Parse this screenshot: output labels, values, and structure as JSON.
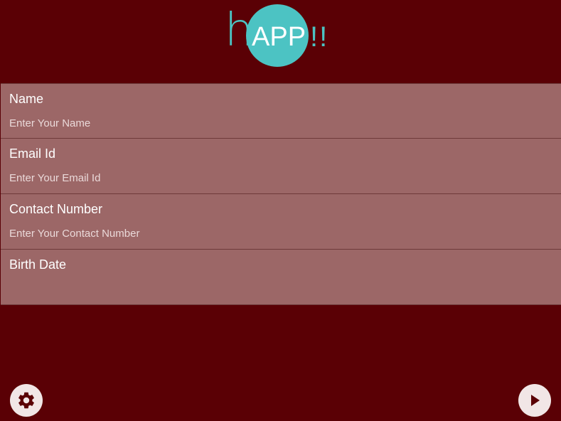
{
  "logo": {
    "h": "h",
    "app": "APP",
    "bang": "!!",
    "colors": {
      "circle": "#4cc3c3",
      "text": "#ffffff"
    }
  },
  "form": {
    "fields": [
      {
        "label": "Name",
        "placeholder": "Enter Your Name",
        "value": ""
      },
      {
        "label": "Email Id",
        "placeholder": "Enter Your Email Id",
        "value": ""
      },
      {
        "label": "Contact Number",
        "placeholder": "Enter Your Contact Number",
        "value": ""
      },
      {
        "label": "Birth Date",
        "placeholder": "",
        "value": ""
      }
    ]
  },
  "buttons": {
    "settings_icon": "gear-icon",
    "next_icon": "play-icon"
  },
  "colors": {
    "background": "#5a0005",
    "field_background": "#9c6767",
    "accent": "#4cc3c3"
  }
}
